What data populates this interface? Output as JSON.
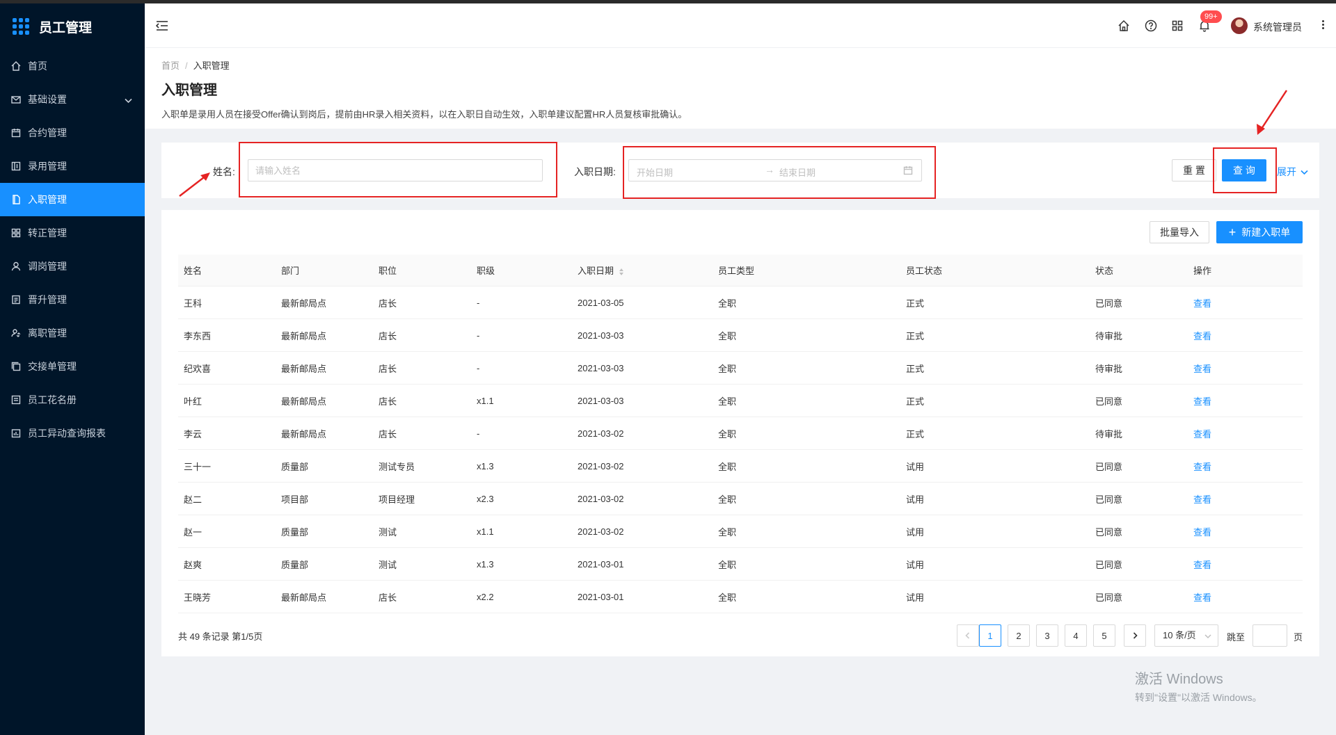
{
  "app": {
    "title": "员工管理"
  },
  "sidebar": {
    "items": [
      {
        "label": "首页",
        "icon": "home-icon"
      },
      {
        "label": "基础设置",
        "icon": "mail-icon"
      },
      {
        "label": "合约管理",
        "icon": "calendar-icon"
      },
      {
        "label": "录用管理",
        "icon": "book-icon"
      },
      {
        "label": "入职管理",
        "icon": "file-icon",
        "active": true
      },
      {
        "label": "转正管理",
        "icon": "grid-icon"
      },
      {
        "label": "调岗管理",
        "icon": "user-icon"
      },
      {
        "label": "晋升管理",
        "icon": "file-text-icon"
      },
      {
        "label": "离职管理",
        "icon": "user-switch-icon"
      },
      {
        "label": "交接单管理",
        "icon": "copy-icon"
      },
      {
        "label": "员工花名册",
        "icon": "profile-icon"
      },
      {
        "label": "员工异动查询报表",
        "icon": "report-icon"
      }
    ]
  },
  "header": {
    "badge": "99+",
    "username": "系统管理员"
  },
  "page": {
    "breadcrumb_home": "首页",
    "breadcrumb_sep": "/",
    "breadcrumb_current": "入职管理",
    "title": "入职管理",
    "description": "入职单是录用人员在接受Offer确认到岗后，提前由HR录入相关资料，以在入职日自动生效，入职单建议配置HR人员复核审批确认。"
  },
  "search": {
    "name_label": "姓名:",
    "name_placeholder": "请输入姓名",
    "date_label": "入职日期:",
    "start_placeholder": "开始日期",
    "end_placeholder": "结束日期",
    "arrow": "→",
    "reset_label": "重 置",
    "query_label": "查 询",
    "expand_label": "展开"
  },
  "toolbar": {
    "import_label": "批量导入",
    "new_label": "新建入职单",
    "new_icon": "+"
  },
  "table": {
    "columns": [
      "姓名",
      "部门",
      "职位",
      "职级",
      "入职日期",
      "员工类型",
      "员工状态",
      "状态",
      "操作"
    ],
    "rows": [
      [
        "王科",
        "最新邮局点",
        "店长",
        "-",
        "2021-03-05",
        "全职",
        "正式",
        "已同意",
        "查看"
      ],
      [
        "李东西",
        "最新邮局点",
        "店长",
        "-",
        "2021-03-03",
        "全职",
        "正式",
        "待审批",
        "查看"
      ],
      [
        "纪欢喜",
        "最新邮局点",
        "店长",
        "-",
        "2021-03-03",
        "全职",
        "正式",
        "待审批",
        "查看"
      ],
      [
        "叶红",
        "最新邮局点",
        "店长",
        "x1.1",
        "2021-03-03",
        "全职",
        "正式",
        "已同意",
        "查看"
      ],
      [
        "李云",
        "最新邮局点",
        "店长",
        "-",
        "2021-03-02",
        "全职",
        "正式",
        "待审批",
        "查看"
      ],
      [
        "三十一",
        "质量部",
        "测试专员",
        "x1.3",
        "2021-03-02",
        "全职",
        "试用",
        "已同意",
        "查看"
      ],
      [
        "赵二",
        "项目部",
        "项目经理",
        "x2.3",
        "2021-03-02",
        "全职",
        "试用",
        "已同意",
        "查看"
      ],
      [
        "赵一",
        "质量部",
        "测试",
        "x1.1",
        "2021-03-02",
        "全职",
        "试用",
        "已同意",
        "查看"
      ],
      [
        "赵爽",
        "质量部",
        "测试",
        "x1.3",
        "2021-03-01",
        "全职",
        "试用",
        "已同意",
        "查看"
      ],
      [
        "王晓芳",
        "最新邮局点",
        "店长",
        "x2.2",
        "2021-03-01",
        "全职",
        "试用",
        "已同意",
        "查看"
      ]
    ]
  },
  "pagination": {
    "total_text": "共 49 条记录 第1/5页",
    "pages": [
      "1",
      "2",
      "3",
      "4",
      "5"
    ],
    "current": "1",
    "page_size": "10 条/页",
    "jump_label": "跳至",
    "page_suffix": "页"
  },
  "watermark": {
    "line1": "激活 Windows",
    "line2": "转到\"设置\"以激活 Windows。"
  },
  "colors": {
    "primary": "#1890ff",
    "sidebar_bg": "#001529",
    "annotation_red": "#e52323",
    "badge": "#ff4d4f"
  }
}
